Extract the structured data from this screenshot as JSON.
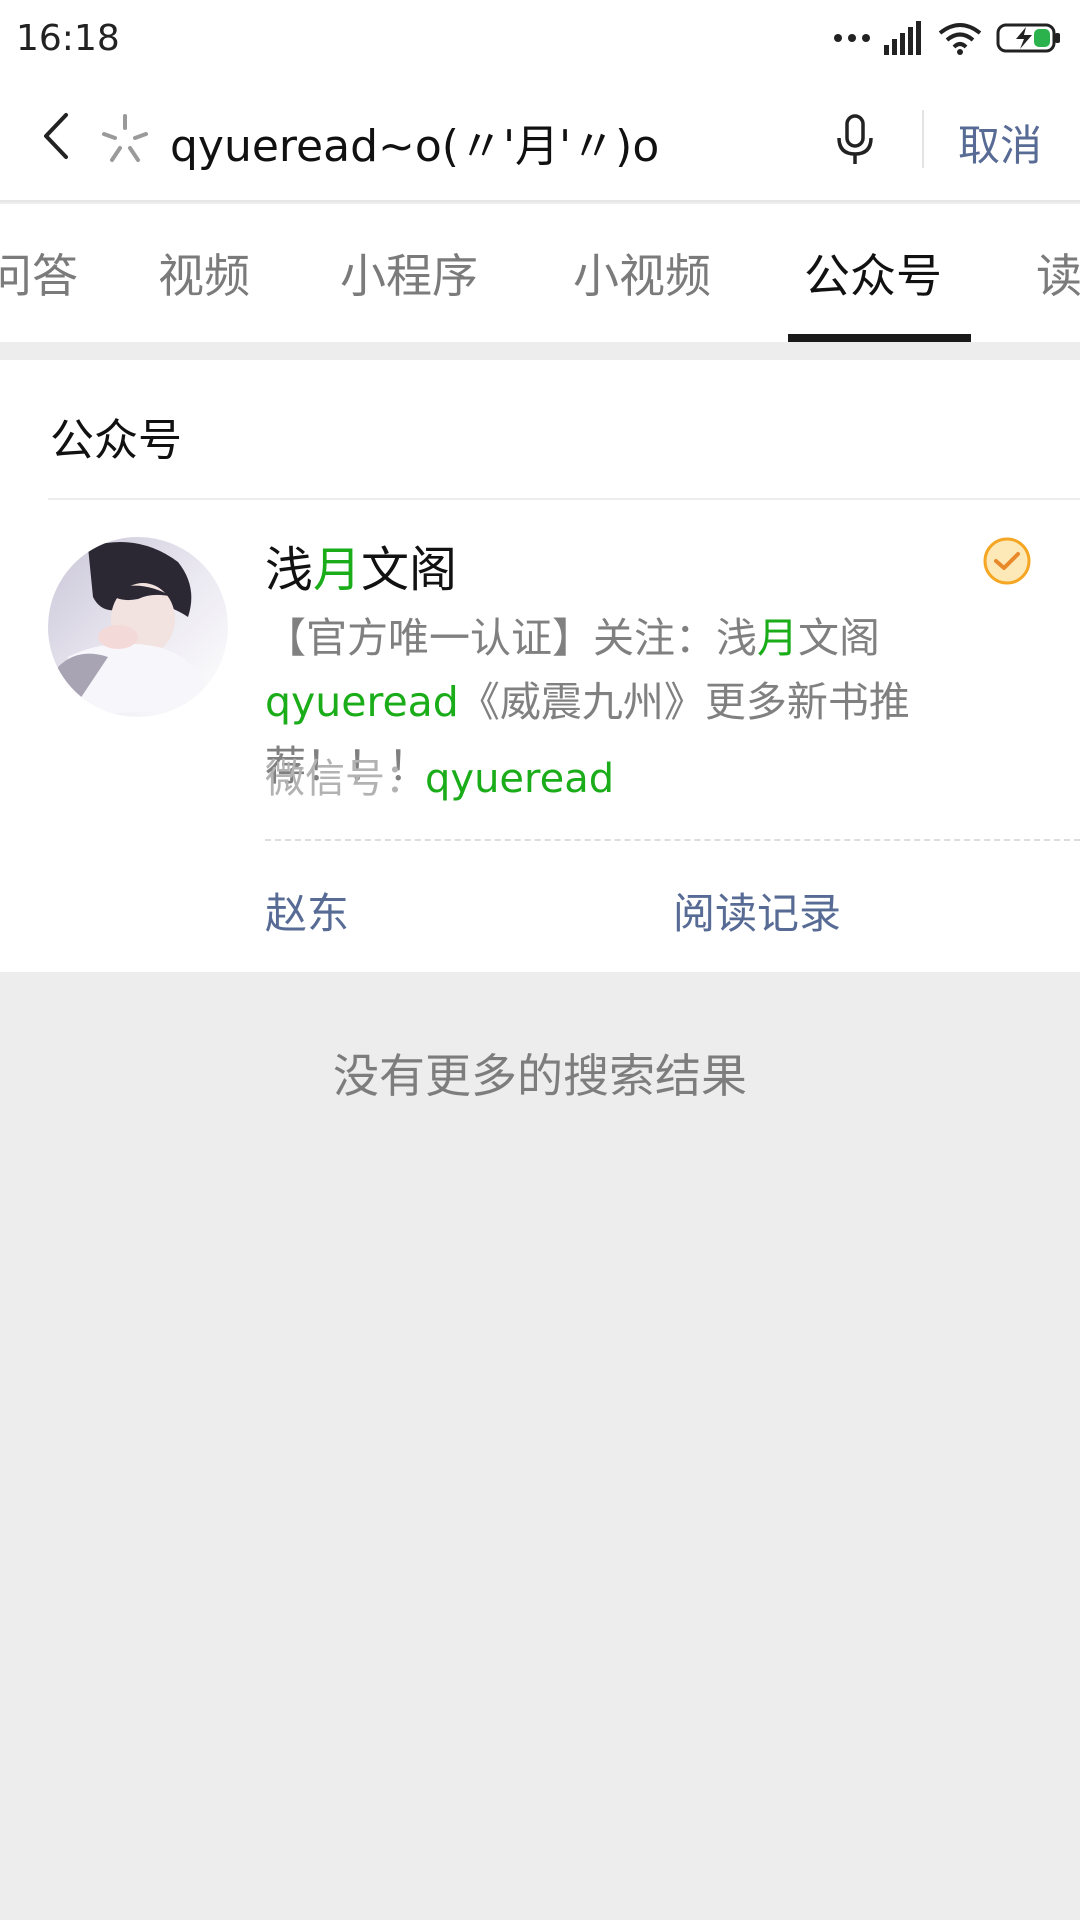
{
  "status_bar": {
    "time": "16:18",
    "icons": [
      "more-dots-icon",
      "signal-icon",
      "wifi-icon",
      "battery-charging-icon"
    ]
  },
  "search": {
    "query": "qyueread~o(〃'月'〃)o",
    "cancel_label": "取消",
    "icons": [
      "back-arrow-icon",
      "sparkle-icon",
      "microphone-icon"
    ]
  },
  "tabs": [
    {
      "label": "问答",
      "active": false
    },
    {
      "label": "视频",
      "active": false
    },
    {
      "label": "小程序",
      "active": false
    },
    {
      "label": "小视频",
      "active": false
    },
    {
      "label": "公众号",
      "active": true
    },
    {
      "label": "读",
      "active": false
    }
  ],
  "result": {
    "section_title": "公众号",
    "account": {
      "name_prefix": "浅",
      "name_highlight": "月",
      "name_suffix": "文阁",
      "verified": true,
      "description": {
        "part1": "【官方唯一认证】关注：浅",
        "hl1": "月",
        "part2": "文阁 ",
        "hl2": "qyueread",
        "part3": "《威震九州》更多新书推荐！！！"
      },
      "wechat_id_label": "微信号：",
      "wechat_id_value": "qyueread"
    },
    "links": [
      "赵东",
      "阅读记录"
    ]
  },
  "footer": {
    "no_more_results": "没有更多的搜索结果"
  },
  "colors": {
    "highlight_green": "#1aad19",
    "link_blue": "#576b95",
    "background_gray": "#ededed",
    "verified_orange": "#f5a623"
  }
}
